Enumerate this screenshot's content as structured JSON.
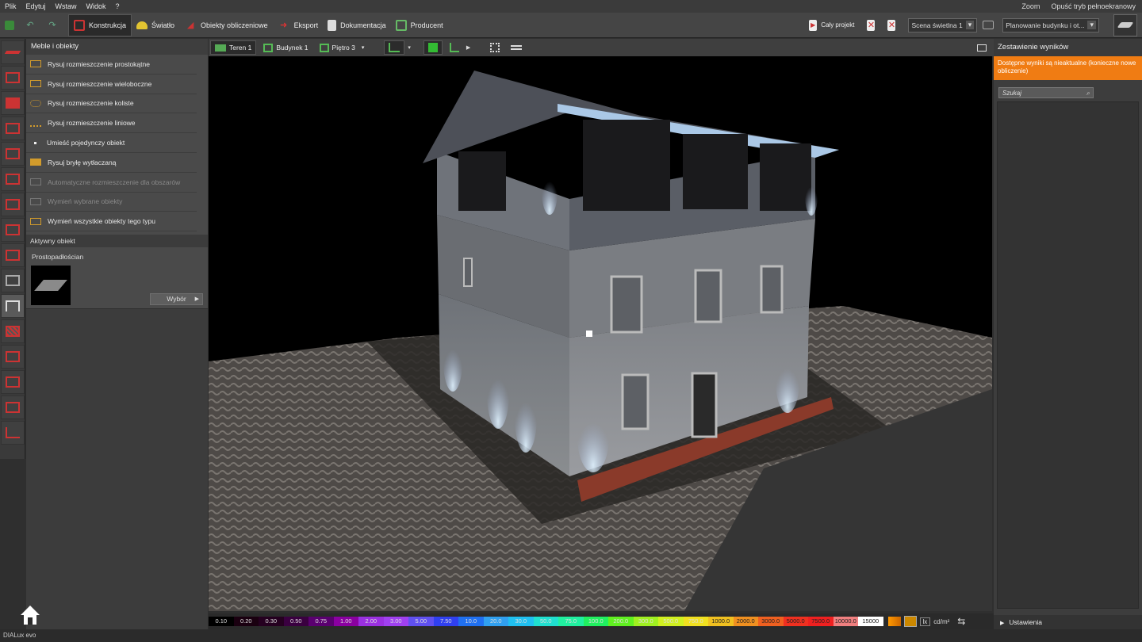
{
  "menu": {
    "items": [
      "Plik",
      "Edytuj",
      "Wstaw",
      "Widok",
      "?"
    ],
    "zoom": "Zoom",
    "fullscreen_exit": "Opuść tryb pełnoekranowy"
  },
  "toolbar": {
    "tabs": [
      "Konstrukcja",
      "Światło",
      "Obiekty obliczeniowe",
      "Eksport",
      "Dokumentacja",
      "Producent"
    ],
    "whole_project": "Cały projekt",
    "scene": "Scena świetlna 1",
    "planning": "Planowanie budynku i ot..."
  },
  "left_panel": {
    "title": "Meble i obiekty",
    "items": [
      {
        "label": "Rysuj rozmieszczenie prostokątne",
        "enabled": true
      },
      {
        "label": "Rysuj rozmieszczenie wieloboczne",
        "enabled": true
      },
      {
        "label": "Rysuj rozmieszczenie koliste",
        "enabled": true
      },
      {
        "label": "Rysuj rozmieszczenie liniowe",
        "enabled": true
      },
      {
        "label": "Umieść pojedynczy obiekt",
        "enabled": true
      },
      {
        "label": "Rysuj bryłę wytłaczaną",
        "enabled": true
      },
      {
        "label": "Automatyczne rozmieszczenie dla obszarów",
        "enabled": false
      },
      {
        "label": "Wymień wybrane obiekty",
        "enabled": false
      },
      {
        "label": "Wymień wszystkie obiekty tego typu",
        "enabled": true
      }
    ],
    "active_header": "Aktywny obiekt",
    "active_name": "Prostopadłościan",
    "select_button": "Wybór"
  },
  "view_toolbar": {
    "terrain": "Teren 1",
    "building": "Budynek 1",
    "floor": "Piętro 3"
  },
  "scale": {
    "values": [
      "0.10",
      "0.20",
      "0.30",
      "0.50",
      "0.75",
      "1.00",
      "2.00",
      "3.00",
      "5.00",
      "7.50",
      "10.0",
      "20.0",
      "30.0",
      "50.0",
      "75.0",
      "100.0",
      "200.0",
      "300.0",
      "500.0",
      "750.0",
      "1000.0",
      "2000.0",
      "3000.0",
      "5000.0",
      "7500.0",
      "10000.0",
      "15000"
    ],
    "colors": [
      "#000000",
      "#1a0010",
      "#250020",
      "#3a0040",
      "#5a0070",
      "#8a00a0",
      "#9a30e0",
      "#a040f0",
      "#6050f0",
      "#3040f0",
      "#2070f0",
      "#30a0f0",
      "#20c0f0",
      "#20e0d0",
      "#20f0a0",
      "#20f060",
      "#60f020",
      "#a0f020",
      "#d0f020",
      "#f0e020",
      "#f0c020",
      "#f09020",
      "#f06020",
      "#f03020",
      "#f02020",
      "#f08080",
      "#ffffff"
    ],
    "unit_lx": "lx",
    "unit_cd": "cd/m²"
  },
  "right_panel": {
    "title": "Zestawienie wyników",
    "warning": "Dostępne wyniki są nieaktualne (konieczne nowe obliczenie)",
    "search_placeholder": "Szukaj",
    "settings": "Ustawienia"
  },
  "status": {
    "logo_text": "DIALux evo"
  }
}
